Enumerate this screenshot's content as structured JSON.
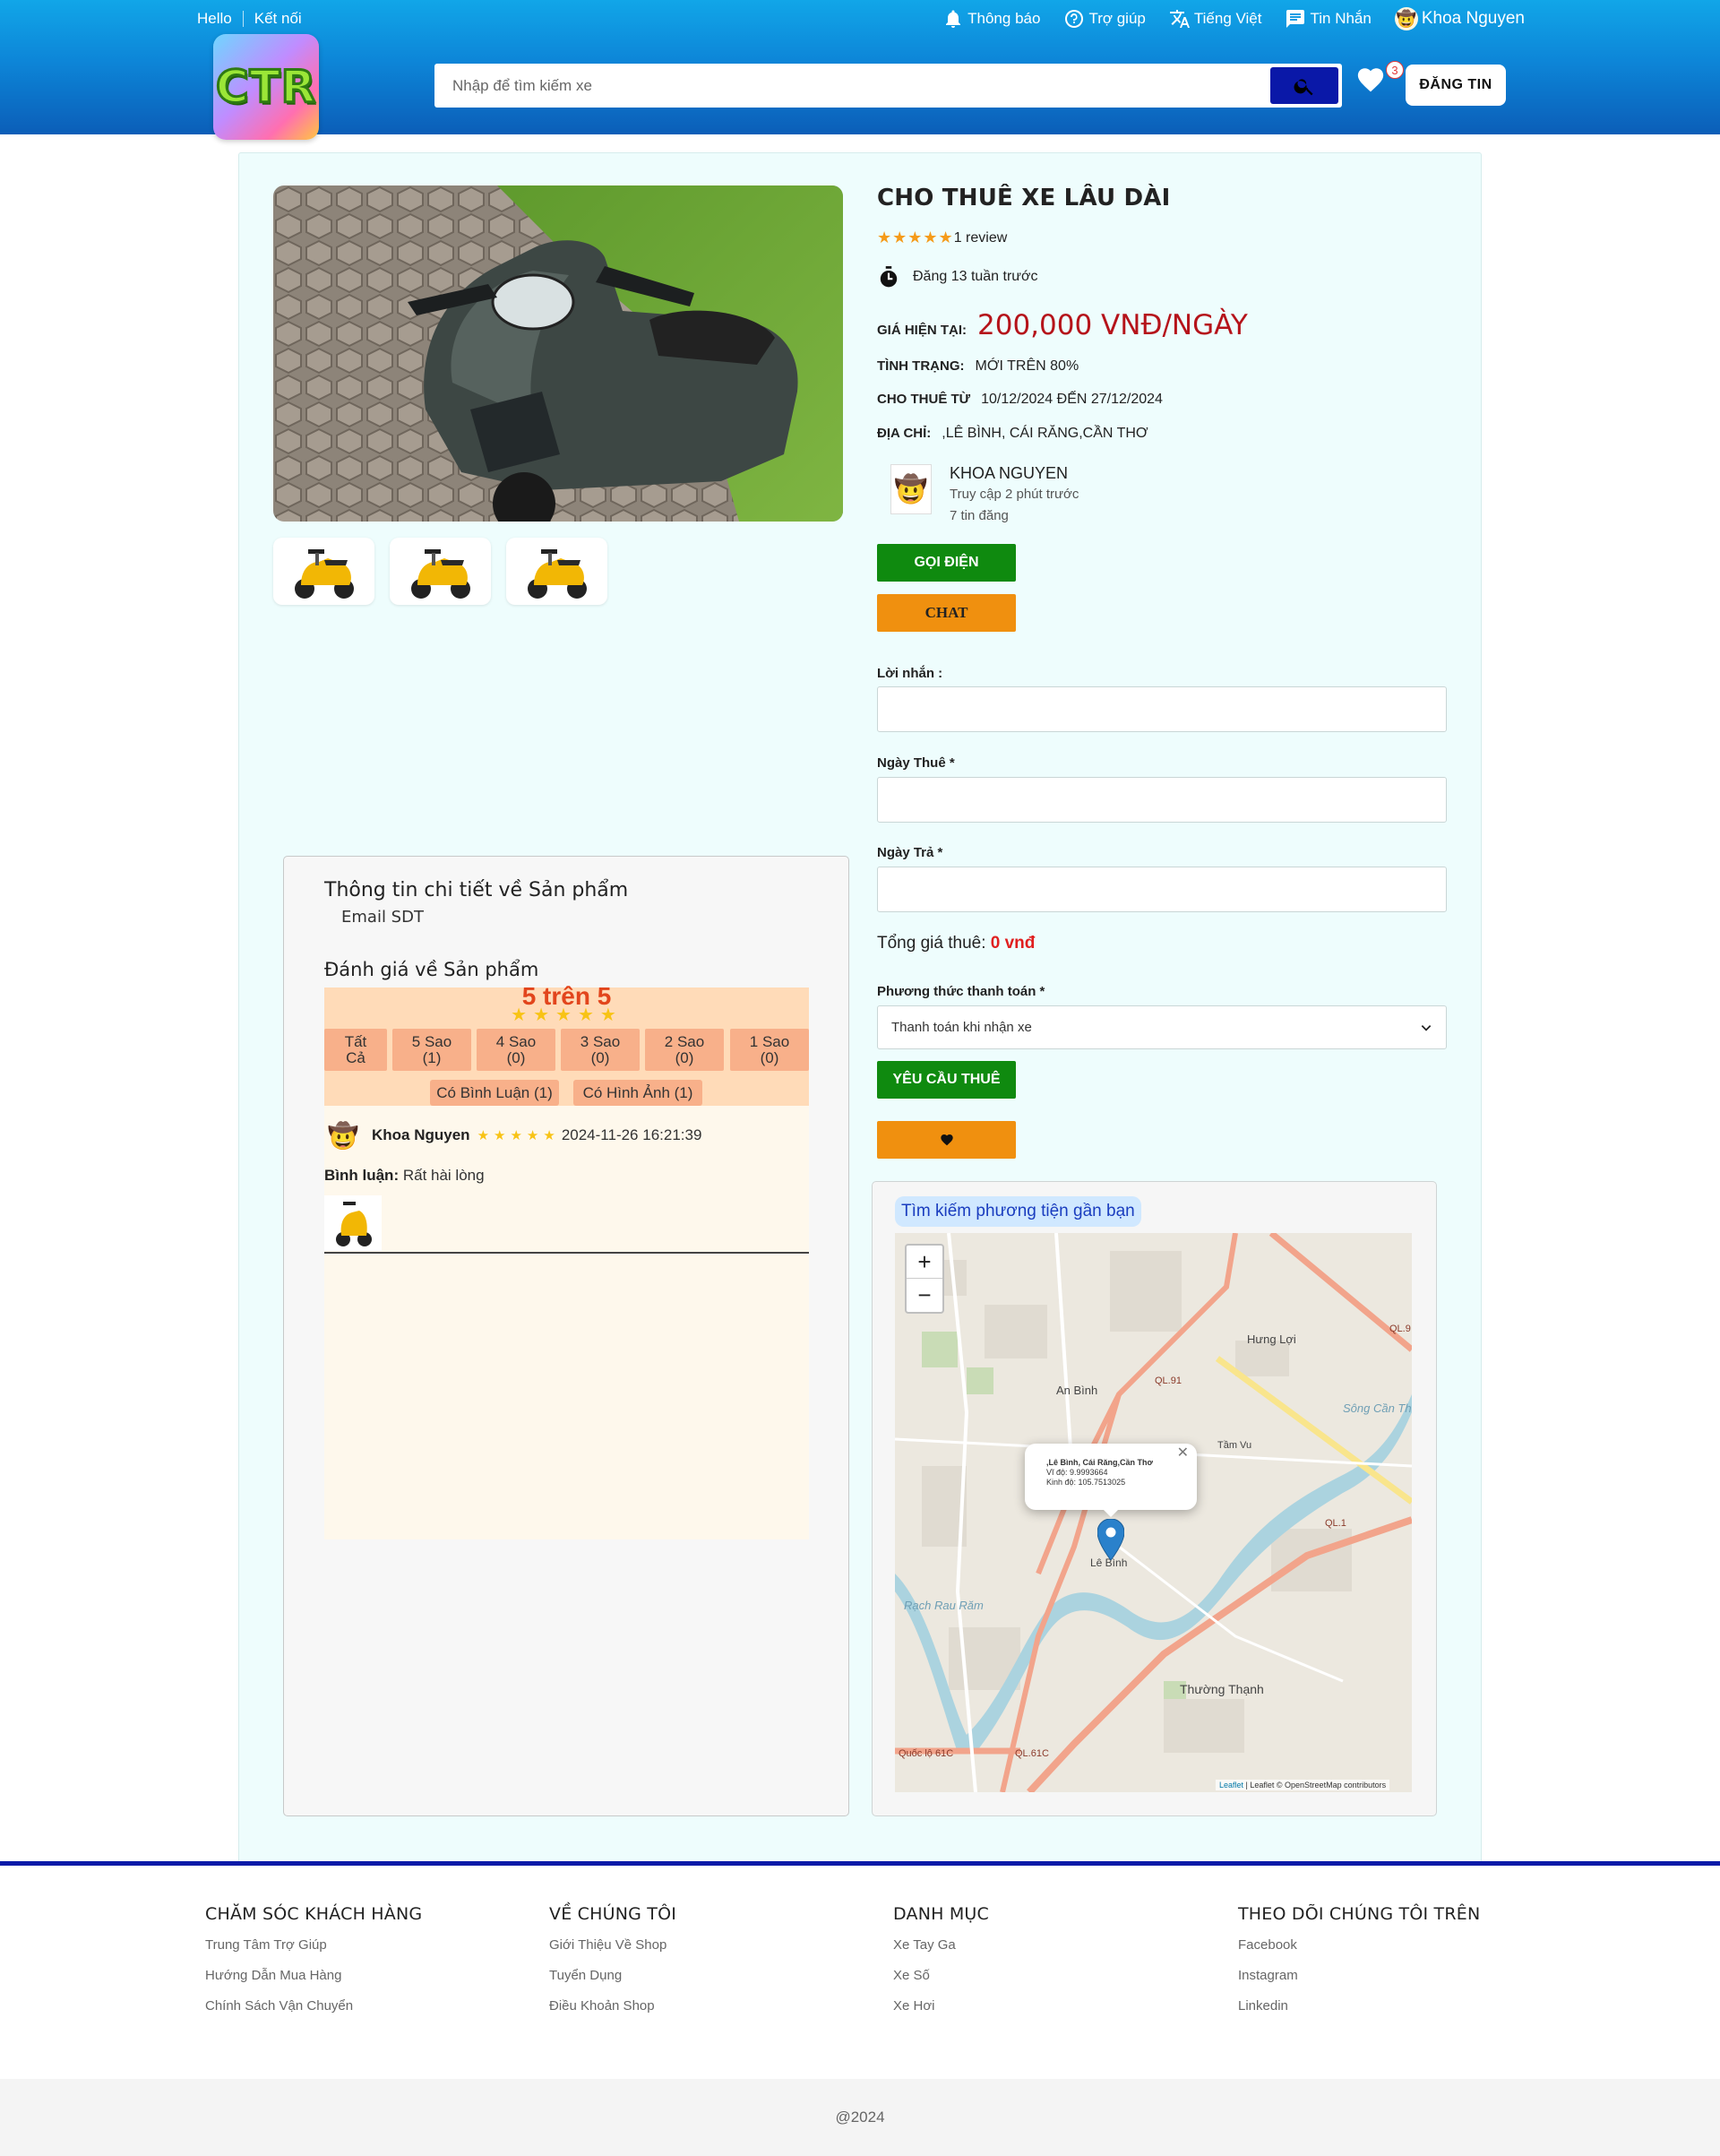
{
  "topbar": {
    "hello": "Hello",
    "connect": "Kết nối",
    "notifications": "Thông báo",
    "help": "Trợ giúp",
    "language": "Tiếng Việt",
    "messages": "Tin Nhắn",
    "user_name": "Khoa Nguyen"
  },
  "header": {
    "logo_text": "CTR",
    "search_placeholder": "Nhập để tìm kiếm xe",
    "favorites_count": "3",
    "post_button": "ĐĂNG TIN"
  },
  "product": {
    "title": "CHO THUÊ XE LÂU DÀI",
    "rating_stars": "★★★★★",
    "review_count": "1 review",
    "posted": "Đăng 13 tuần trước",
    "price_label": "GIÁ HIỆN TẠI:",
    "price": "200,000 VNĐ/NGÀY",
    "condition_label": "TÌNH TRẠNG:",
    "condition": "MỚI TRÊN 80%",
    "rent_from_label": "CHO THUÊ TỪ",
    "rent_period": "10/12/2024 ĐẾN 27/12/2024",
    "address_label": "ĐỊA CHỈ:",
    "address": ",LÊ BÌNH, CÁI RĂNG,CẦN THƠ"
  },
  "seller": {
    "name": "KHOA NGUYEN",
    "last_seen": "Truy cập 2 phút trước",
    "post_count": "7 tin đăng"
  },
  "actions": {
    "call": "GỌI ĐIỆN",
    "chat": "CHAT",
    "request_rent": "YÊU CẦU THUÊ",
    "favorite_icon": "heart-icon"
  },
  "form": {
    "message_label": "Lời nhắn :",
    "message_value": "",
    "rent_date_label": "Ngày Thuê *",
    "rent_date_value": "",
    "return_date_label": "Ngày Trả *",
    "return_date_value": "",
    "total_label": "Tổng giá thuê:",
    "total_value": "0 vnđ",
    "payment_label": "Phương thức thanh toán *",
    "payment_selected": "Thanh toán khi nhận xe"
  },
  "map": {
    "title": "Tìm kiếm phương tiện gần bạn",
    "zoom_in": "+",
    "zoom_out": "−",
    "popup_address": ",Lê Bình, Cái Răng,Cần Thơ",
    "popup_lat": "Vĩ độ: 9.9993664",
    "popup_lng": "Kinh độ: 105.7513025",
    "labels": {
      "an_binh": "An Bình",
      "hung_loi": "Hưng Lợi",
      "le_binh": "Lê Bình",
      "thuong_thanh": "Thường Thạnh",
      "ql91": "QL.91",
      "ql1": "QL.1",
      "ql9": "QL.9",
      "ql61c": "QL.61C",
      "quoc_lo_61c": "Quốc lộ 61C",
      "song_can_tho": "Sông Cần Thơ",
      "tam_vu": "Tầm Vu",
      "rach": "Rạch Rau Răm"
    },
    "attribution_link": "Leaflet",
    "attribution_text": "| Leaflet © OpenStreetMap contributors"
  },
  "details": {
    "heading": "Thông tin chi tiết về Sản phẩm",
    "sub": "Email SDT",
    "review_heading": "Đánh giá về Sản phẩm",
    "score": "5 trên 5",
    "score_stars": "★★★★★",
    "filters": [
      {
        "line1": "Tất",
        "line2": "Cả"
      },
      {
        "line1": "5 Sao",
        "line2": "(1)"
      },
      {
        "line1": "4 Sao",
        "line2": "(0)"
      },
      {
        "line1": "3 Sao",
        "line2": "(0)"
      },
      {
        "line1": "2 Sao",
        "line2": "(0)"
      },
      {
        "line1": "1 Sao",
        "line2": "(0)"
      }
    ],
    "with_comment": "Có Bình Luận (1)",
    "with_image": "Có Hình Ảnh (1)",
    "review": {
      "name": "Khoa Nguyen",
      "stars": "★★★★★",
      "date": "2024-11-26 16:21:39",
      "comment_label": "Bình luận:",
      "comment": "Rất hài lòng"
    }
  },
  "footer": {
    "cols": [
      {
        "title": "CHĂM SÓC KHÁCH HÀNG",
        "links": [
          "Trung Tâm Trợ Giúp",
          "Hướng Dẫn Mua Hàng",
          "Chính Sách Vận Chuyển"
        ]
      },
      {
        "title": "VỀ CHÚNG TÔI",
        "links": [
          "Giới Thiệu Về Shop",
          "Tuyển Dụng",
          "Điều Khoản Shop"
        ]
      },
      {
        "title": "DANH MỤC",
        "links": [
          "Xe Tay Ga",
          "Xe Số",
          "Xe Hơi"
        ]
      },
      {
        "title": "THEO DÕI CHÚNG TÔI TRÊN",
        "links": [
          "Facebook",
          "Instagram",
          "Linkedin"
        ]
      }
    ],
    "copyright": "@2024"
  },
  "colors": {
    "header_top": "#11a6e8",
    "header_bottom": "#0b5eb8",
    "price": "#b5131a",
    "green_button": "#0f8a0f",
    "orange_button": "#f0900f",
    "footer_line": "#0b1aa8"
  }
}
